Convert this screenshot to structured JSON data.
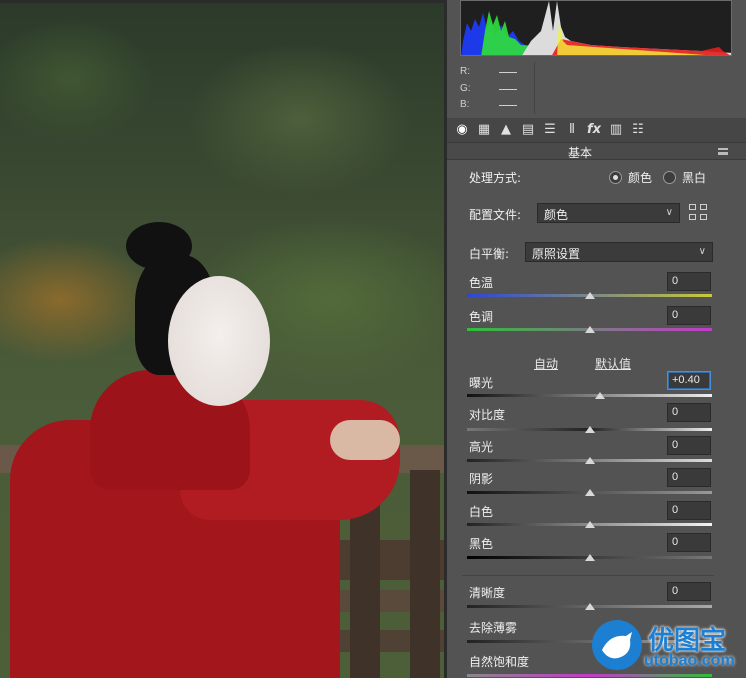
{
  "histogram": {
    "readout": [
      {
        "channel": "R:"
      },
      {
        "channel": "G:"
      },
      {
        "channel": "B:"
      }
    ]
  },
  "toolbar": {
    "icons": [
      "aperture-icon",
      "grid-icon",
      "mountain-icon",
      "split-tone-icon",
      "hsl-icon",
      "lens-icon",
      "fx-icon",
      "camera-calibration-icon",
      "presets-icon"
    ],
    "fx_label": "fx"
  },
  "section": {
    "title": "基本"
  },
  "process": {
    "label": "处理方式:",
    "options": [
      {
        "label": "颜色",
        "selected": true
      },
      {
        "label": "黑白",
        "selected": false
      }
    ]
  },
  "profile": {
    "label": "配置文件:",
    "value": "颜色"
  },
  "white_balance": {
    "label": "白平衡:",
    "value": "原照设置"
  },
  "sliders_wb": [
    {
      "label": "色温",
      "value": "0",
      "level": 0.5
    },
    {
      "label": "色调",
      "value": "0",
      "level": 0.5
    }
  ],
  "tone_links": {
    "auto": "自动",
    "default": "默认值"
  },
  "sliders_tone": [
    {
      "label": "曝光",
      "value": "+0.40",
      "level": 0.54
    },
    {
      "label": "对比度",
      "value": "0",
      "level": 0.5
    },
    {
      "label": "高光",
      "value": "0",
      "level": 0.5
    },
    {
      "label": "阴影",
      "value": "0",
      "level": 0.5
    },
    {
      "label": "白色",
      "value": "0",
      "level": 0.5
    },
    {
      "label": "黑色",
      "value": "0",
      "level": 0.5
    }
  ],
  "sliders_presence": [
    {
      "label": "清晰度",
      "value": "0",
      "level": 0.5
    },
    {
      "label": "去除薄雾",
      "value": "",
      "level": 0.5
    },
    {
      "label": "自然饱和度",
      "value": "",
      "level": 0.5
    }
  ],
  "watermark": {
    "title": "优图宝",
    "url": "utobao.com"
  },
  "colors": {
    "accent": "#4a90d9",
    "panel": "#535353",
    "watermark": "#1c7fd1",
    "robe": "#a3161c"
  }
}
